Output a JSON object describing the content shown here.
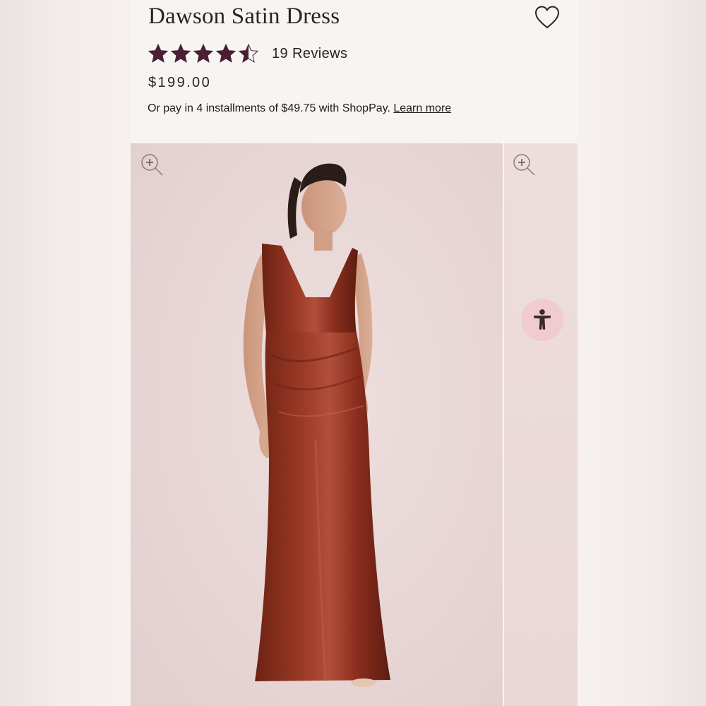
{
  "product": {
    "title": "Dawson Satin Dress",
    "rating": 4.5,
    "rating_max": 5,
    "reviews_label": "19 Reviews",
    "price": "$199.00",
    "installments": {
      "text": "Or pay in 4 installments of $49.75 with ShopPay.",
      "link_label": "Learn more"
    }
  },
  "icons": {
    "wishlist": "heart-outline-icon",
    "zoom": "zoom-plus-icon",
    "accessibility": "accessibility-person-icon",
    "star": "star-icon"
  },
  "colors": {
    "star": "#4a1f35",
    "text": "#2a2226",
    "dress": "#8a2e1e",
    "accessibility_bg": "#f0cbd0",
    "photo_bg": "#e7d6d5"
  }
}
